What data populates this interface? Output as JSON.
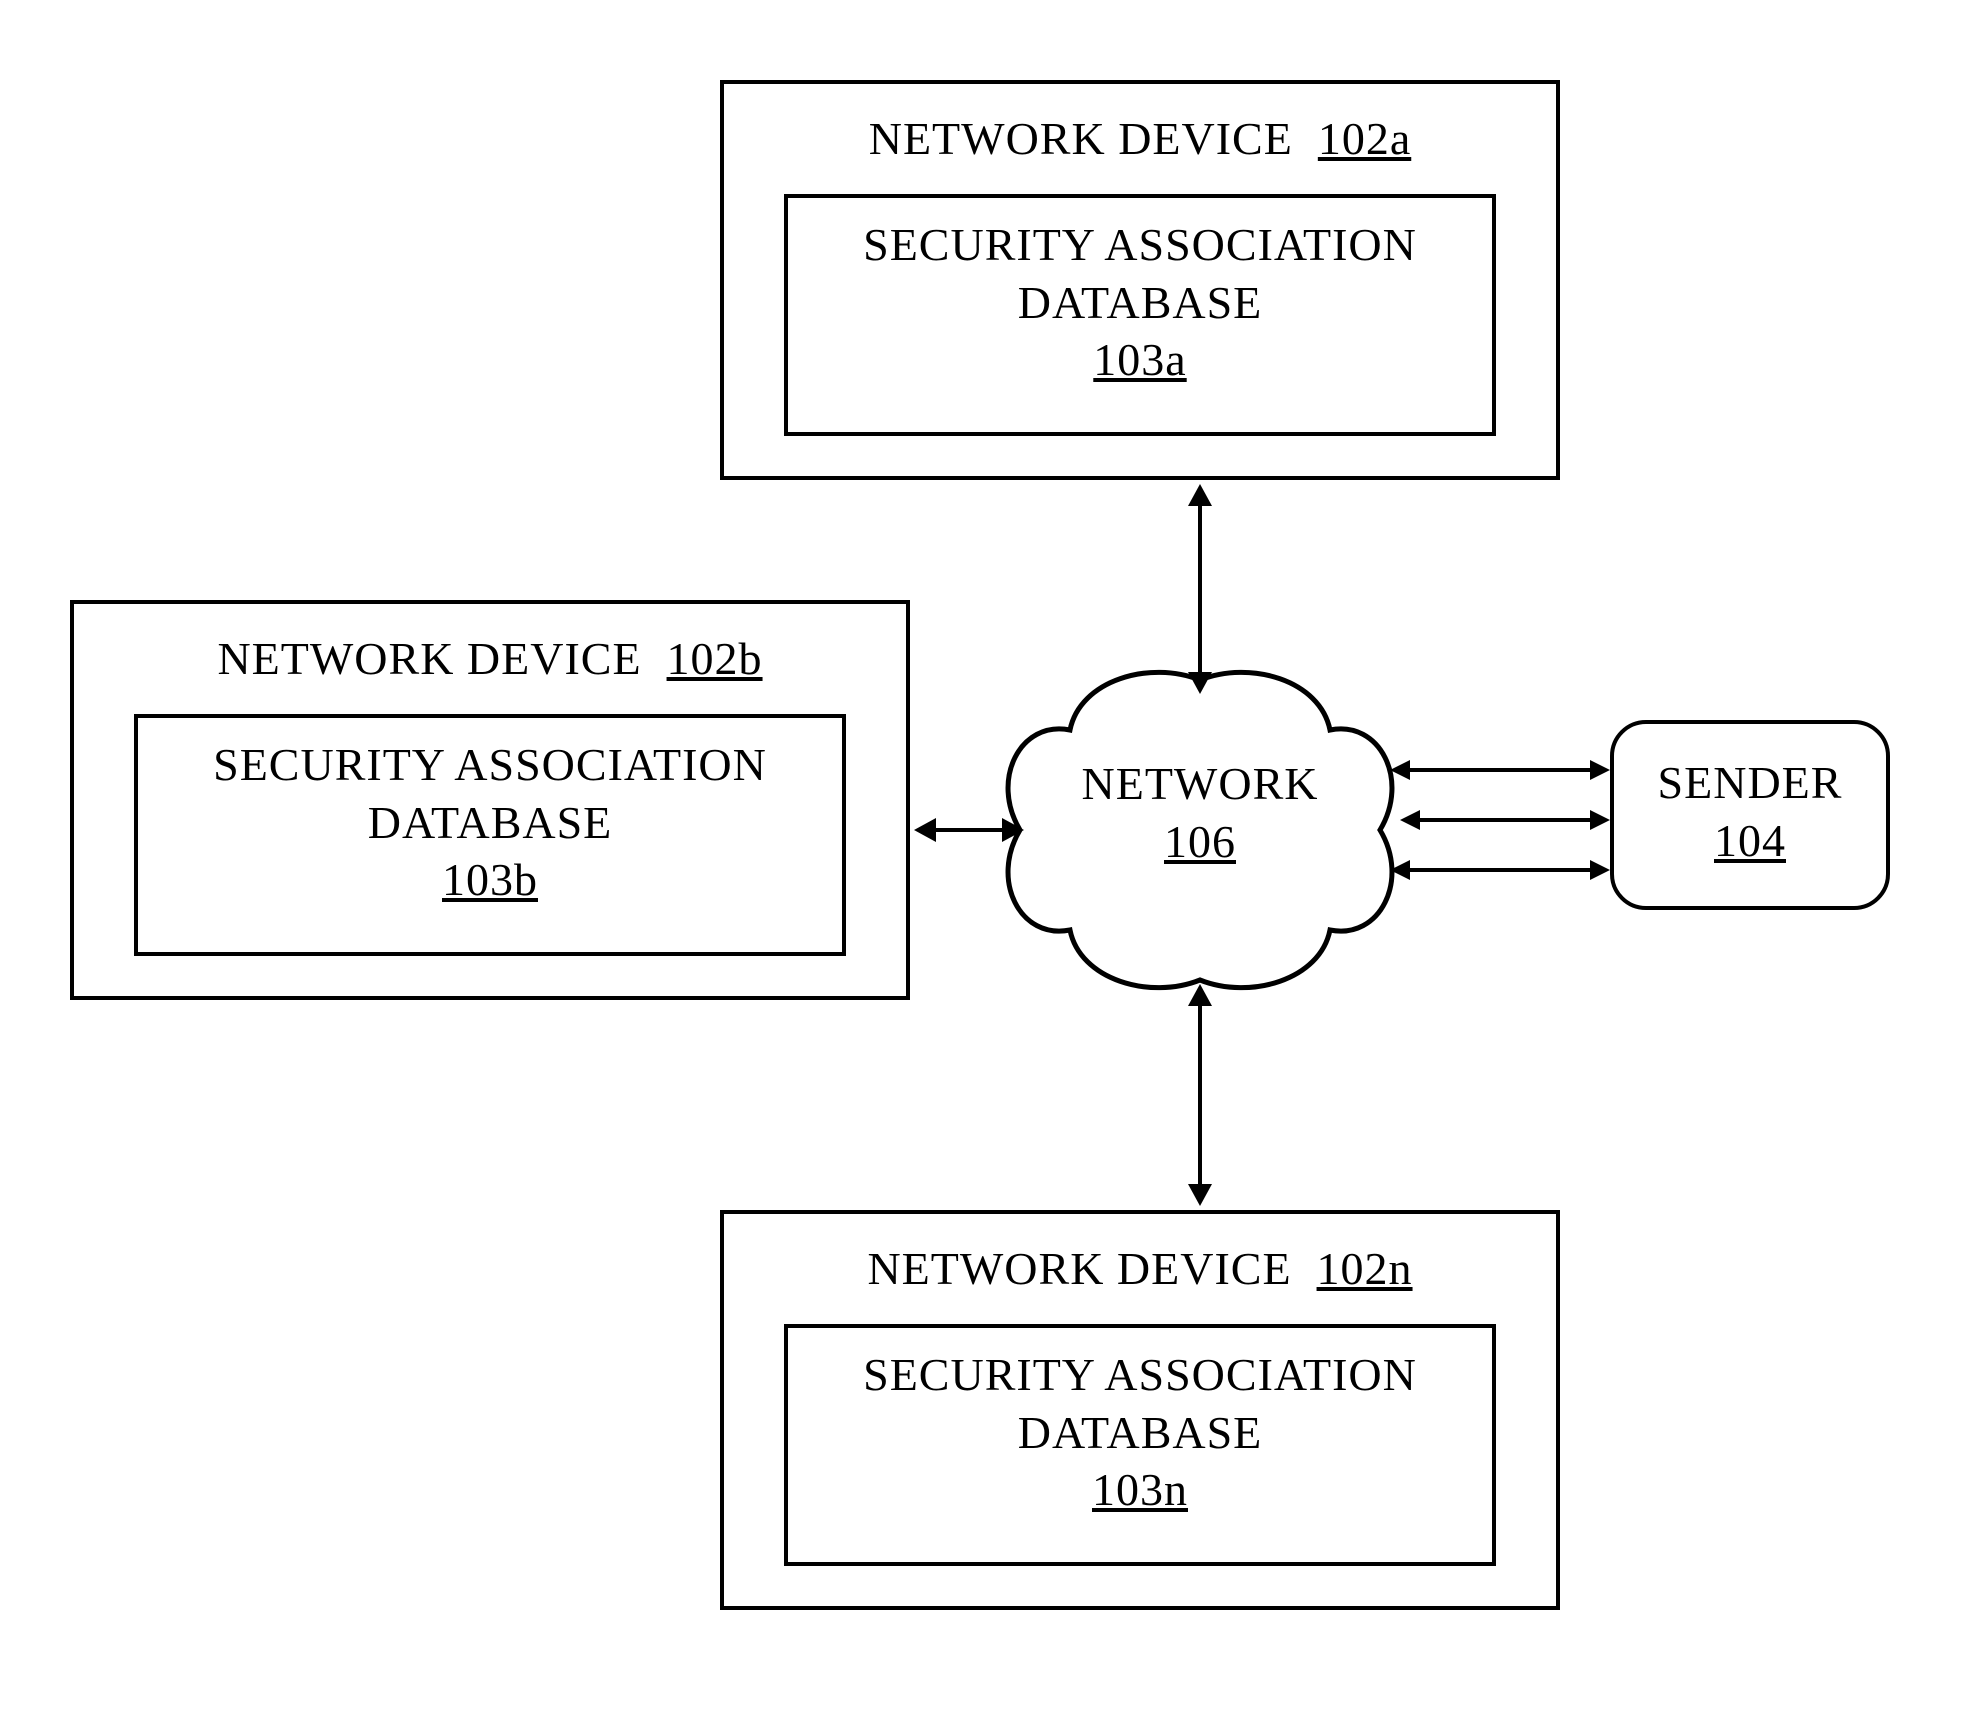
{
  "devices": {
    "a": {
      "title_label": "NETWORK DEVICE",
      "title_ref": "102a",
      "db_label": "SECURITY ASSOCIATION\nDATABASE",
      "db_ref": "103a"
    },
    "b": {
      "title_label": "NETWORK DEVICE",
      "title_ref": "102b",
      "db_label": "SECURITY ASSOCIATION\nDATABASE",
      "db_ref": "103b"
    },
    "n": {
      "title_label": "NETWORK DEVICE",
      "title_ref": "102n",
      "db_label": "SECURITY ASSOCIATION\nDATABASE",
      "db_ref": "103n"
    }
  },
  "network": {
    "label": "NETWORK",
    "ref": "106"
  },
  "sender": {
    "label": "SENDER",
    "ref": "104"
  }
}
